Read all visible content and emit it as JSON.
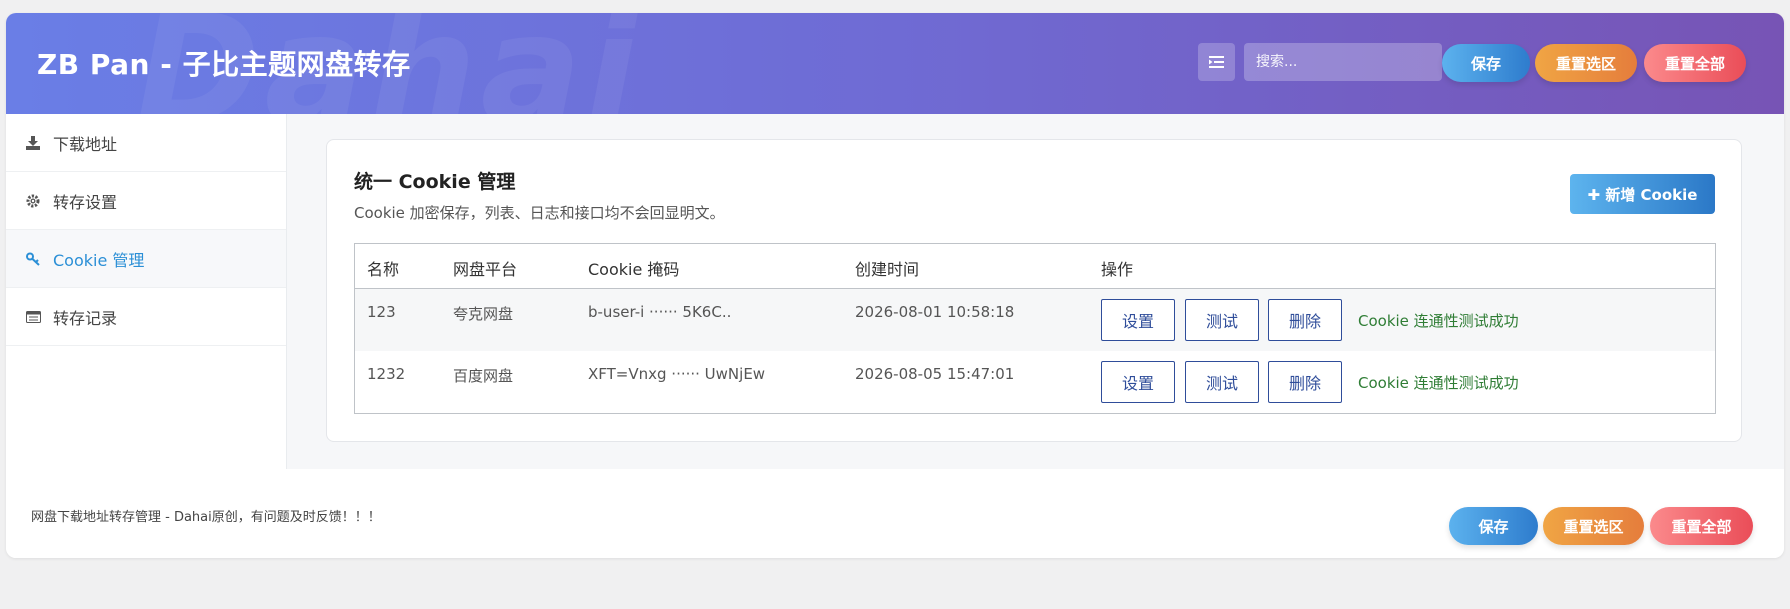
{
  "header": {
    "title": "ZB Pan - 子比主题网盘转存",
    "watermark": "Dahai",
    "search_placeholder": "搜索...",
    "buttons": {
      "save": "保存",
      "reset_selection": "重置选区",
      "reset_all": "重置全部"
    }
  },
  "sidebar": {
    "items": [
      {
        "label": "下载地址",
        "icon": "download-icon",
        "active": false
      },
      {
        "label": "转存设置",
        "icon": "gear-icon",
        "active": false
      },
      {
        "label": "Cookie 管理",
        "icon": "key-icon",
        "active": true
      },
      {
        "label": "转存记录",
        "icon": "list-icon",
        "active": false
      }
    ]
  },
  "card": {
    "title": "统一 Cookie 管理",
    "description": "Cookie 加密保存，列表、日志和接口均不会回显明文。",
    "add_button": "✚ 新增 Cookie",
    "columns": [
      "名称",
      "网盘平台",
      "Cookie 掩码",
      "创建时间",
      "操作"
    ],
    "rows": [
      {
        "name": "123",
        "platform": "夸克网盘",
        "mask": "b-user-i ······ 5K6C..",
        "created": "2026-08-01 10:58:18",
        "status": "Cookie 连通性测试成功"
      },
      {
        "name": "1232",
        "platform": "百度网盘",
        "mask": "XFT=Vnxg ······ UwNjEw",
        "created": "2026-08-05 15:47:01",
        "status": "Cookie 连通性测试成功"
      }
    ],
    "row_actions": {
      "settings": "设置",
      "test": "测试",
      "delete": "删除"
    }
  },
  "footer": {
    "text": "网盘下载地址转存管理 - Dahai原创，有问题及时反馈！！！",
    "buttons": {
      "save": "保存",
      "reset_selection": "重置选区",
      "reset_all": "重置全部"
    }
  },
  "colors": {
    "header_gradient": [
      "#6a7ee6",
      "#7754b5"
    ],
    "active_nav": "#2b8fd6",
    "action_border": "#2f4d9a",
    "status_text": "#2f7d35"
  }
}
